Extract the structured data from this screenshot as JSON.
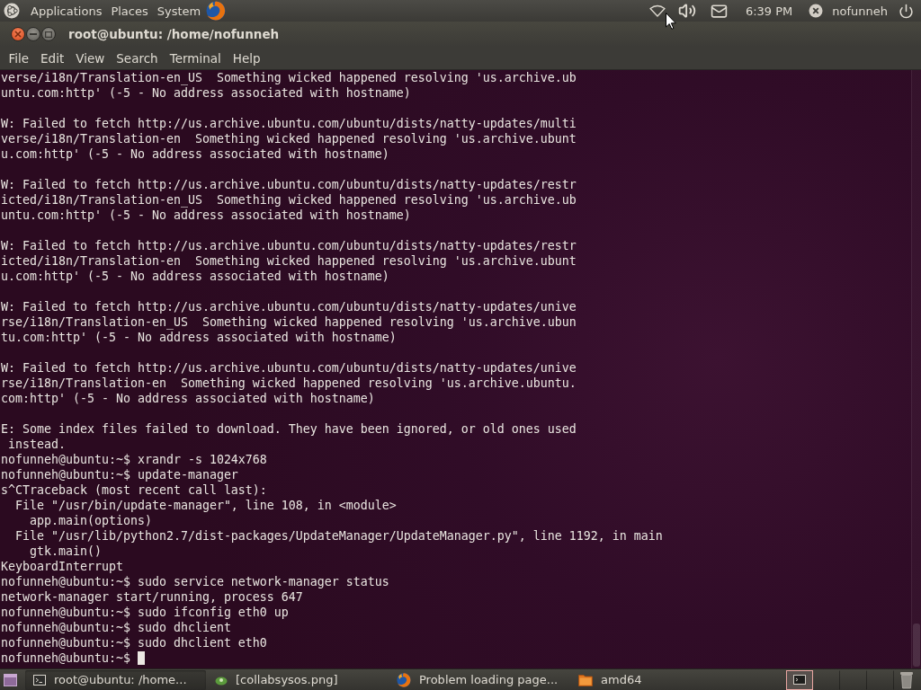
{
  "top_panel": {
    "menus": [
      "Applications",
      "Places",
      "System"
    ],
    "clock": "6:39 PM",
    "user": "nofunneh"
  },
  "window": {
    "title": "root@ubuntu: /home/nofunneh",
    "menu": [
      "File",
      "Edit",
      "View",
      "Search",
      "Terminal",
      "Help"
    ]
  },
  "terminal": {
    "blocks": [
      [
        "verse/i18n/Translation-en_US  Something wicked happened resolving 'us.archive.ub",
        "untu.com:http' (-5 - No address associated with hostname)"
      ],
      [
        "W: Failed to fetch http://us.archive.ubuntu.com/ubuntu/dists/natty-updates/multi",
        "verse/i18n/Translation-en  Something wicked happened resolving 'us.archive.ubunt",
        "u.com:http' (-5 - No address associated with hostname)"
      ],
      [
        "W: Failed to fetch http://us.archive.ubuntu.com/ubuntu/dists/natty-updates/restr",
        "icted/i18n/Translation-en_US  Something wicked happened resolving 'us.archive.ub",
        "untu.com:http' (-5 - No address associated with hostname)"
      ],
      [
        "W: Failed to fetch http://us.archive.ubuntu.com/ubuntu/dists/natty-updates/restr",
        "icted/i18n/Translation-en  Something wicked happened resolving 'us.archive.ubunt",
        "u.com:http' (-5 - No address associated with hostname)"
      ],
      [
        "W: Failed to fetch http://us.archive.ubuntu.com/ubuntu/dists/natty-updates/unive",
        "rse/i18n/Translation-en_US  Something wicked happened resolving 'us.archive.ubun",
        "tu.com:http' (-5 - No address associated with hostname)"
      ],
      [
        "W: Failed to fetch http://us.archive.ubuntu.com/ubuntu/dists/natty-updates/unive",
        "rse/i18n/Translation-en  Something wicked happened resolving 'us.archive.ubuntu.",
        "com:http' (-5 - No address associated with hostname)"
      ],
      [
        "E: Some index files failed to download. They have been ignored, or old ones used",
        " instead.",
        "nofunneh@ubuntu:~$ xrandr -s 1024x768",
        "nofunneh@ubuntu:~$ update-manager",
        "s^CTraceback (most recent call last):",
        "  File \"/usr/bin/update-manager\", line 108, in <module>",
        "    app.main(options)",
        "  File \"/usr/lib/python2.7/dist-packages/UpdateManager/UpdateManager.py\", line 1192, in main",
        "    gtk.main()",
        "KeyboardInterrupt",
        "nofunneh@ubuntu:~$ sudo service network-manager status",
        "network-manager start/running, process 647",
        "nofunneh@ubuntu:~$ sudo ifconfig eth0 up",
        "nofunneh@ubuntu:~$ sudo dhclient",
        "nofunneh@ubuntu:~$ sudo dhclient eth0"
      ]
    ],
    "prompt": "nofunneh@ubuntu:~$"
  },
  "taskbar": {
    "tasks": [
      {
        "label": "root@ubuntu: /home...",
        "kind": "terminal",
        "selected": true
      },
      {
        "label": "[collabsysos.png]",
        "kind": "image",
        "selected": false
      },
      {
        "label": "Problem loading page...",
        "kind": "browser",
        "selected": false
      },
      {
        "label": "amd64",
        "kind": "folder",
        "selected": false
      }
    ],
    "workspaces": [
      {
        "selected": true
      },
      {
        "selected": false
      },
      {
        "selected": false
      },
      {
        "selected": false
      }
    ]
  }
}
